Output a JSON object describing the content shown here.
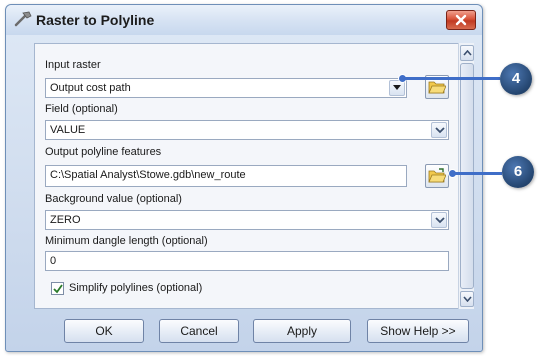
{
  "window": {
    "title": "Raster to Polyline"
  },
  "form": {
    "input_raster": {
      "label": "Input raster",
      "value": "Output cost path"
    },
    "field": {
      "label": "Field (optional)",
      "value": "VALUE"
    },
    "output_features": {
      "label": "Output polyline features",
      "value": "C:\\Spatial  Analyst\\Stowe.gdb\\new_route"
    },
    "background_value": {
      "label": "Background value (optional)",
      "value": "ZERO"
    },
    "min_dangle": {
      "label": "Minimum dangle length (optional)",
      "value": "0"
    },
    "simplify": {
      "label": "Simplify polylines (optional)",
      "checked": true
    }
  },
  "buttons": {
    "ok": "OK",
    "cancel": "Cancel",
    "apply": "Apply",
    "help": "Show Help >>"
  },
  "callouts": {
    "first": "4",
    "second": "6"
  },
  "colors": {
    "callout_line": "#3f6ec8",
    "callout_badge": "#24456f",
    "close_button": "#c03a22"
  }
}
